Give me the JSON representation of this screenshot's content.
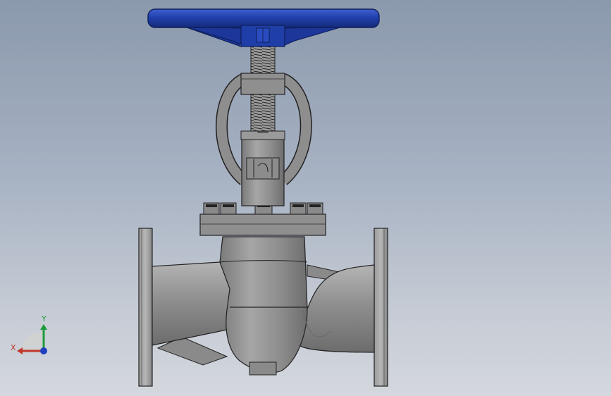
{
  "triad": {
    "x_label": "X",
    "y_label": "Y",
    "colors": {
      "x": "#c0392b",
      "y": "#1e9b3c",
      "z": "#1f3fbf"
    }
  },
  "watermark": {
    "text": ""
  },
  "colors": {
    "handwheel": "#1f3ea8",
    "body": "#8e8e8e",
    "outline": "#222222"
  }
}
